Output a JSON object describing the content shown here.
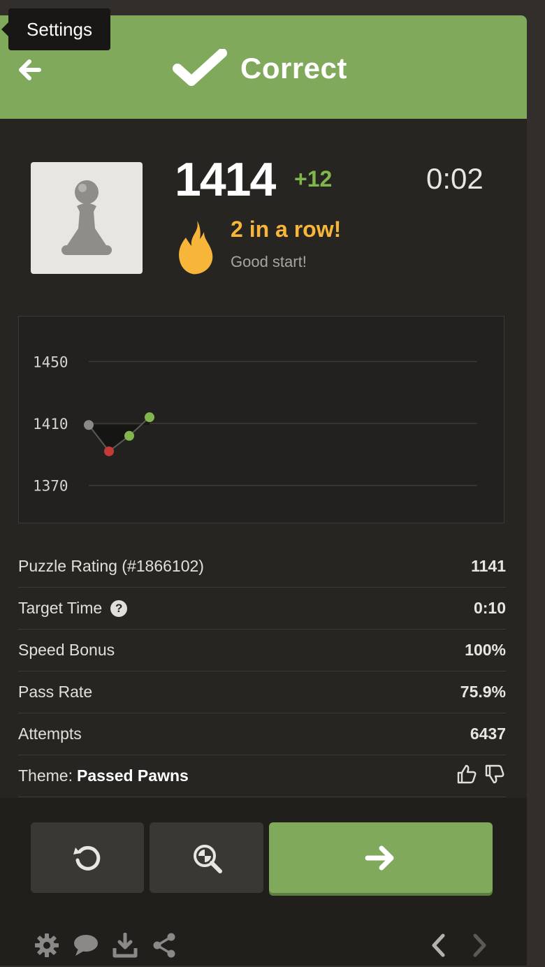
{
  "tooltip": {
    "text": "Settings"
  },
  "header": {
    "result_label": "Correct",
    "color": "#81a95b"
  },
  "player": {
    "rating": "1414",
    "rating_delta": "+12",
    "timer": "0:02",
    "streak_title": "2 in a row!",
    "streak_subtitle": "Good start!"
  },
  "chart_data": {
    "type": "line",
    "yticks": [
      "1450",
      "1410",
      "1370"
    ],
    "ylim": [
      1355,
      1470
    ],
    "points": [
      {
        "x": 0,
        "y": 1409,
        "status": "start"
      },
      {
        "x": 1,
        "y": 1392,
        "status": "incorrect"
      },
      {
        "x": 2,
        "y": 1402,
        "status": "correct"
      },
      {
        "x": 3,
        "y": 1414,
        "status": "correct"
      }
    ],
    "colors": {
      "start": "#8b8987",
      "incorrect": "#c33a37",
      "correct": "#81b64c"
    }
  },
  "stats": {
    "rows": [
      {
        "label": "Puzzle Rating (#1866102)",
        "value": "1141"
      },
      {
        "label": "Target Time",
        "value": "0:10"
      },
      {
        "label": "Speed Bonus",
        "value": "100%"
      },
      {
        "label": "Pass Rate",
        "value": "75.9%"
      },
      {
        "label": "Attempts",
        "value": "6437"
      }
    ],
    "theme_label": "Theme:",
    "theme_value": "Passed Pawns"
  },
  "icons": {
    "back": "arrow-left-icon",
    "check": "checkmark-icon",
    "flame": "flame-icon",
    "help": "question-icon",
    "retry": "retry-icon",
    "analyze": "analysis-magnifier-icon",
    "next": "arrow-right-icon",
    "settings": "gear-icon",
    "chat": "chat-icon",
    "download": "download-icon",
    "share": "share-icon"
  }
}
